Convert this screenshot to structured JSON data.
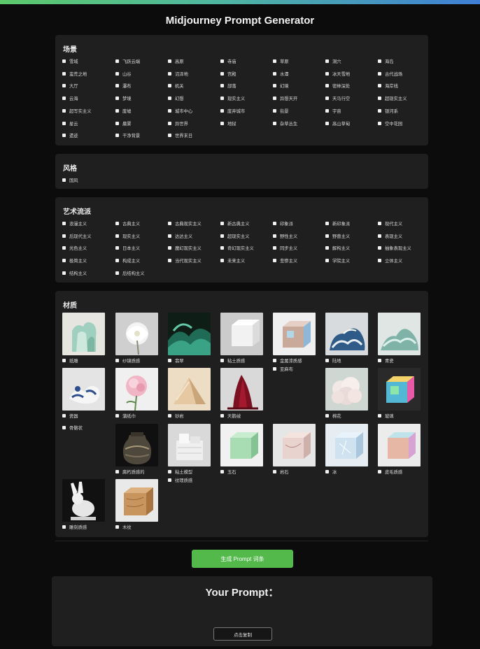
{
  "app": {
    "title": "Midjourney Prompt Generator"
  },
  "scene": {
    "title": "场景",
    "items": [
      "雪域",
      "飞跃云端",
      "高原",
      "寺庙",
      "草原",
      "洞穴",
      "海岛",
      "蛮荒之地",
      "山谷",
      "沼泽地",
      "宫殿",
      "水潭",
      "冰天雪地",
      "古代战场",
      "大厅",
      "瀑布",
      "机关",
      "部落",
      "幻境",
      "密林深处",
      "海岸线",
      "云海",
      "梦境",
      "幻想",
      "现实主义",
      "异想天开",
      "天马行空",
      "超现实主义",
      "超写实主义",
      "废墟",
      "城市中心",
      "废弃城市",
      "街景",
      "宇宙",
      "银河系",
      "星云",
      "晨雾",
      "异世界",
      "地狱",
      "杂草丛生",
      "高山草甸",
      "空中花园",
      "遗迹",
      "干净背景",
      "世界末日"
    ]
  },
  "style": {
    "title": "风格",
    "items": [
      "国风"
    ]
  },
  "art": {
    "title": "艺术流派",
    "items": [
      "浪漫主义",
      "古典主义",
      "古典现实主义",
      "新古典主义",
      "印象派",
      "新印象派",
      "现代主义",
      "后现代主义",
      "现实主义",
      "达达主义",
      "超现实主义",
      "野性主义",
      "野兽主义",
      "表现主义",
      "光色主义",
      "日本主义",
      "魔幻现实主义",
      "奇幻现实主义",
      "同步主义",
      "解构主义",
      "抽象表现主义",
      "极简主义",
      "构成主义",
      "当代现实主义",
      "未来主义",
      "悲惨主义",
      "学院主义",
      "立体主义",
      "结构主义",
      "后结构主义"
    ]
  },
  "material": {
    "title": "材质",
    "items": [
      {
        "label": "纸雕",
        "thumb": "paper-sculpture"
      },
      {
        "label": "纱镜质感",
        "thumb": "white-flower"
      },
      {
        "label": "翡翠",
        "thumb": "jade-waves"
      },
      {
        "label": "粘土质感",
        "thumb": "white-clay"
      },
      {
        "label": "金属漆质感",
        "thumb": "metallic-cube"
      },
      {
        "label": "亚麻布",
        "thumb": ""
      },
      {
        "label": "陆地",
        "thumb": "wave-sculpture"
      },
      {
        "label": "青瓷",
        "thumb": "celadon-waves"
      },
      {
        "label": "瓷器",
        "thumb": "porcelain"
      },
      {
        "label": "蒲纸巾",
        "thumb": "pink-carnation"
      },
      {
        "label": "砂岩",
        "thumb": "sandstone-pyramid"
      },
      {
        "label": "天鹅绒",
        "thumb": "red-velvet"
      },
      {
        "label": "棉花",
        "thumb": "cotton"
      },
      {
        "label": "玻璃",
        "thumb": "glass-cube"
      },
      {
        "label": "骨骼状",
        "thumb": ""
      },
      {
        "label": "腐朽质感的",
        "thumb": "old-jar"
      },
      {
        "label": "粘土模型",
        "thumb": "clay-model"
      },
      {
        "label": "纹理质感",
        "thumb": ""
      },
      {
        "label": "玉石",
        "thumb": "jade-cube"
      },
      {
        "label": "岩石",
        "thumb": "marble-cube"
      },
      {
        "label": "冰",
        "thumb": "ice-cube"
      },
      {
        "label": "皮毛质感",
        "thumb": "fur-cube"
      },
      {
        "label": "雕刻质感",
        "thumb": "rabbit-sculpture"
      },
      {
        "label": "木纹",
        "thumb": "wood-cube"
      }
    ]
  },
  "generate_button": "生成 Prompt 词条",
  "prompt": {
    "title": "Your Prompt：",
    "text": "",
    "copy_button": "点击复制"
  }
}
